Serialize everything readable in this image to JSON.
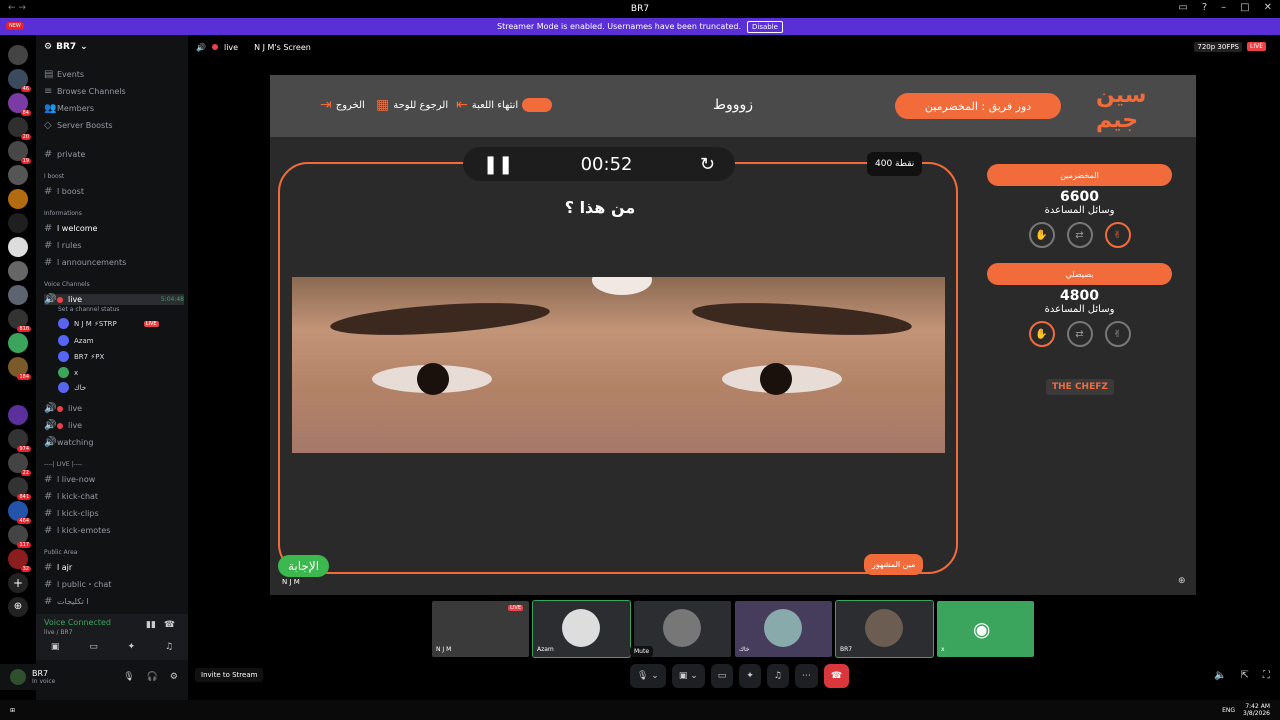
{
  "window": {
    "title": "BR7"
  },
  "streamer": {
    "message": "Streamer Mode is enabled. Usernames have been truncated.",
    "disable": "Disable"
  },
  "servers": {
    "new_badge": "NEW",
    "badges": [
      "46",
      "84",
      "20",
      "19",
      "818",
      "184",
      "974",
      "22",
      "841",
      "464",
      "117",
      "32"
    ]
  },
  "guild": {
    "name": "BR7",
    "nav": [
      "Events",
      "Browse Channels",
      "Members",
      "Server Boosts"
    ],
    "channels": {
      "private": "private",
      "boost_cat": "ا boost",
      "boost": "ا boost",
      "info_cat": "Informations",
      "welcome": "ا welcome",
      "rules": "ا rules",
      "announcements": "ا announcements",
      "voice_cat": "Voice Channels",
      "live_voice": "live",
      "live_time": "5:04:48",
      "channel_status": "Set a channel status",
      "voice_users": [
        "N J M ⚡STRP",
        "Azam",
        "BR7 ⚡PX",
        "x",
        "خاك"
      ],
      "live_badge": "LIVE",
      "live2": "live",
      "live3": "live",
      "watching": "watching",
      "live_cat": "----| LIVE |----",
      "live_now": "ا live-now",
      "kick_chat": "ا kick-chat",
      "kick_clips": "ا kick-clips",
      "kick_emotes": "ا kick-emotes",
      "public_cat": "Public Area",
      "ajr": "ا ajr",
      "public_chat": "ا public・chat",
      "last": "ا تكليجات"
    }
  },
  "voice_panel": {
    "status": "Voice Connected",
    "sub": "live / BR7"
  },
  "user_panel": {
    "name": "BR7",
    "status": "In voice"
  },
  "topbar": {
    "channel": "live",
    "screen": "N J M's Screen",
    "quality": "720p 30FPS",
    "live": "LIVE"
  },
  "game": {
    "word": "زوووط",
    "turn": "دور فريق : المخضرمين",
    "logo": "سين جيم",
    "end_game": "انتهاء اللعبة",
    "back_board": "الرجوع للوحة",
    "exit": "الخروج",
    "timer": "00:52",
    "points": "400 نقطة",
    "question": "من هذا ؟",
    "answer": "الإجابة",
    "presenter": "N J M",
    "celebrity": "مين المشهور",
    "teams": [
      {
        "name": "المخضرمين",
        "score": "6600",
        "help": "وسائل المساعدة"
      },
      {
        "name": "بصيصلي",
        "score": "4800",
        "help": "وسائل المساعدة"
      }
    ],
    "sponsor": "THE CHEFZ"
  },
  "participants": [
    {
      "label": "N J M",
      "live": "LIVE"
    },
    {
      "label": "Azam"
    },
    {
      "label": "x"
    },
    {
      "label": "خاك"
    },
    {
      "label": "BR7"
    },
    {
      "label": "x"
    }
  ],
  "controls": {
    "mute_tooltip": "Mute",
    "invite": "Invite to Stream"
  },
  "taskbar": {
    "lang": "ENG",
    "time": "7:42 AM",
    "date": "3/8/2026"
  }
}
